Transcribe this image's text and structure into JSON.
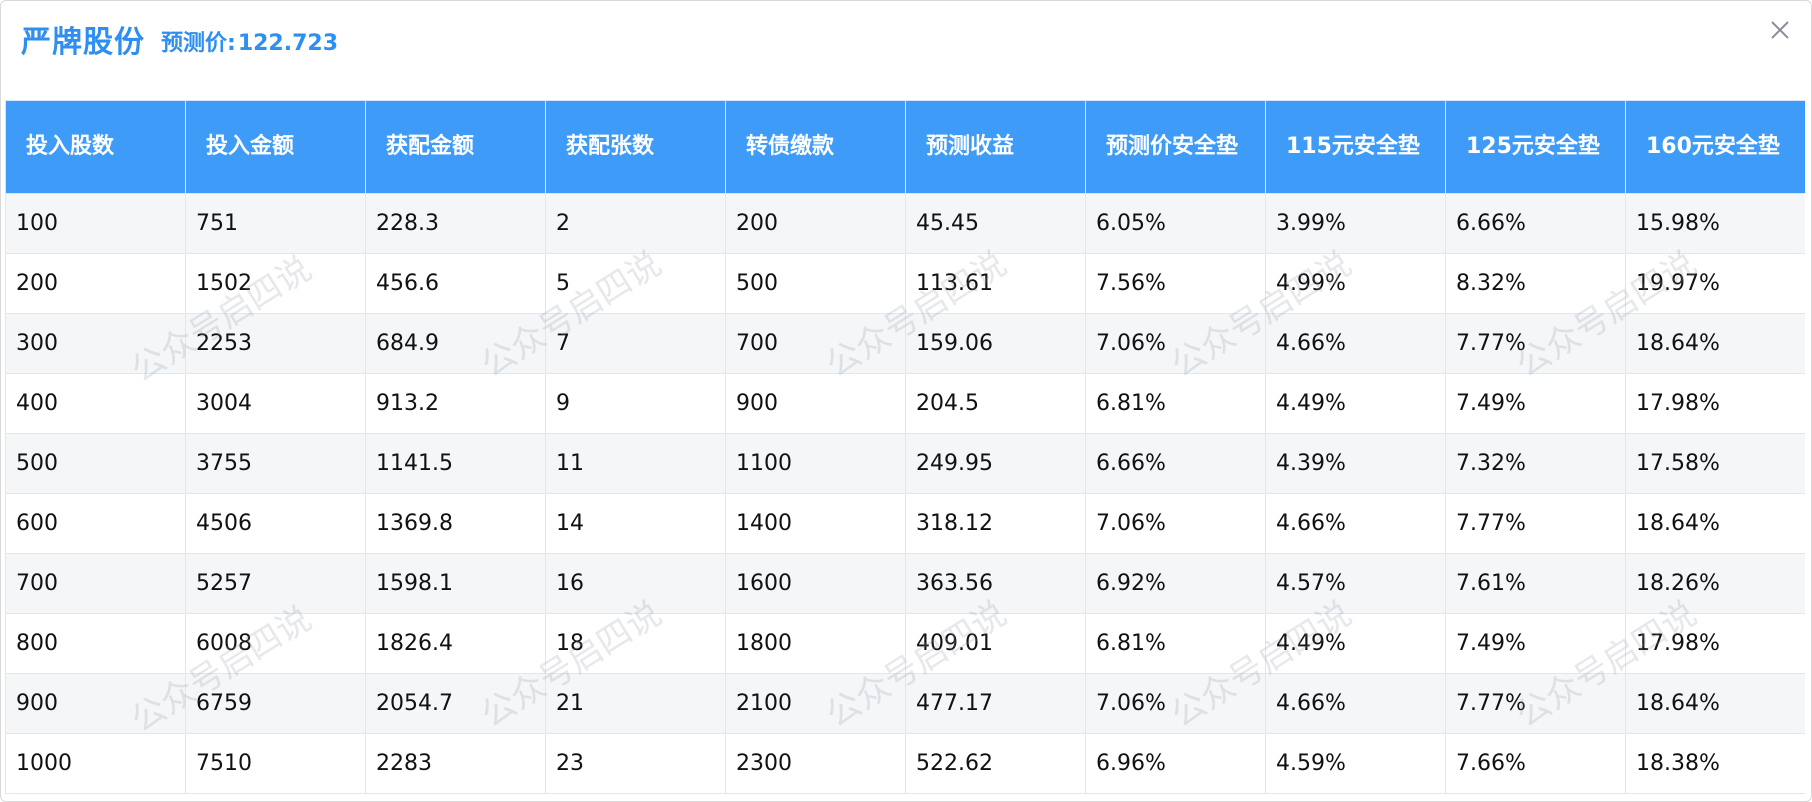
{
  "dialog": {
    "title": "严牌股份",
    "subtitle_label": "预测价:",
    "subtitle_value": "122.723"
  },
  "table": {
    "headers": [
      "投入股数",
      "投入金额",
      "获配金额",
      "获配张数",
      "转债缴款",
      "预测收益",
      "预测价安全垫",
      "115元安全垫",
      "125元安全垫",
      "160元安全垫"
    ],
    "rows": [
      [
        "100",
        "751",
        "228.3",
        "2",
        "200",
        "45.45",
        "6.05%",
        "3.99%",
        "6.66%",
        "15.98%"
      ],
      [
        "200",
        "1502",
        "456.6",
        "5",
        "500",
        "113.61",
        "7.56%",
        "4.99%",
        "8.32%",
        "19.97%"
      ],
      [
        "300",
        "2253",
        "684.9",
        "7",
        "700",
        "159.06",
        "7.06%",
        "4.66%",
        "7.77%",
        "18.64%"
      ],
      [
        "400",
        "3004",
        "913.2",
        "9",
        "900",
        "204.5",
        "6.81%",
        "4.49%",
        "7.49%",
        "17.98%"
      ],
      [
        "500",
        "3755",
        "1141.5",
        "11",
        "1100",
        "249.95",
        "6.66%",
        "4.39%",
        "7.32%",
        "17.58%"
      ],
      [
        "600",
        "4506",
        "1369.8",
        "14",
        "1400",
        "318.12",
        "7.06%",
        "4.66%",
        "7.77%",
        "18.64%"
      ],
      [
        "700",
        "5257",
        "1598.1",
        "16",
        "1600",
        "363.56",
        "6.92%",
        "4.57%",
        "7.61%",
        "18.26%"
      ],
      [
        "800",
        "6008",
        "1826.4",
        "18",
        "1800",
        "409.01",
        "6.81%",
        "4.49%",
        "7.49%",
        "17.98%"
      ],
      [
        "900",
        "6759",
        "2054.7",
        "21",
        "2100",
        "477.17",
        "7.06%",
        "4.66%",
        "7.77%",
        "18.64%"
      ],
      [
        "1000",
        "7510",
        "2283",
        "23",
        "2300",
        "522.62",
        "6.96%",
        "4.59%",
        "7.66%",
        "18.38%"
      ]
    ]
  },
  "watermark": {
    "text": "公众号启四说"
  },
  "colors": {
    "accent": "#2f8ff0",
    "header_bg": "#3e9bf8"
  },
  "icons": {
    "close": "close-icon"
  }
}
